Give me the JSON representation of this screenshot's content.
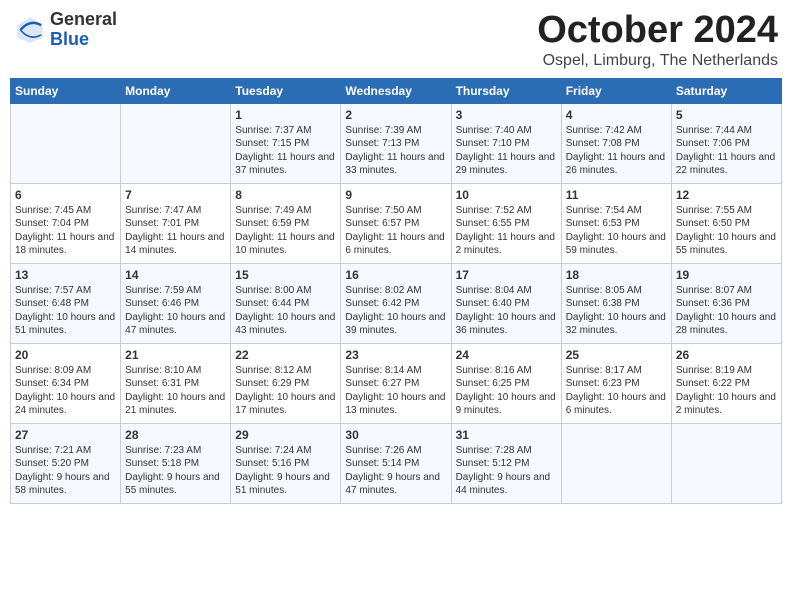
{
  "header": {
    "logo_general": "General",
    "logo_blue": "Blue",
    "month": "October 2024",
    "location": "Ospel, Limburg, The Netherlands"
  },
  "days_of_week": [
    "Sunday",
    "Monday",
    "Tuesday",
    "Wednesday",
    "Thursday",
    "Friday",
    "Saturday"
  ],
  "weeks": [
    [
      {
        "day": "",
        "info": ""
      },
      {
        "day": "",
        "info": ""
      },
      {
        "day": "1",
        "info": "Sunrise: 7:37 AM\nSunset: 7:15 PM\nDaylight: 11 hours and 37 minutes."
      },
      {
        "day": "2",
        "info": "Sunrise: 7:39 AM\nSunset: 7:13 PM\nDaylight: 11 hours and 33 minutes."
      },
      {
        "day": "3",
        "info": "Sunrise: 7:40 AM\nSunset: 7:10 PM\nDaylight: 11 hours and 29 minutes."
      },
      {
        "day": "4",
        "info": "Sunrise: 7:42 AM\nSunset: 7:08 PM\nDaylight: 11 hours and 26 minutes."
      },
      {
        "day": "5",
        "info": "Sunrise: 7:44 AM\nSunset: 7:06 PM\nDaylight: 11 hours and 22 minutes."
      }
    ],
    [
      {
        "day": "6",
        "info": "Sunrise: 7:45 AM\nSunset: 7:04 PM\nDaylight: 11 hours and 18 minutes."
      },
      {
        "day": "7",
        "info": "Sunrise: 7:47 AM\nSunset: 7:01 PM\nDaylight: 11 hours and 14 minutes."
      },
      {
        "day": "8",
        "info": "Sunrise: 7:49 AM\nSunset: 6:59 PM\nDaylight: 11 hours and 10 minutes."
      },
      {
        "day": "9",
        "info": "Sunrise: 7:50 AM\nSunset: 6:57 PM\nDaylight: 11 hours and 6 minutes."
      },
      {
        "day": "10",
        "info": "Sunrise: 7:52 AM\nSunset: 6:55 PM\nDaylight: 11 hours and 2 minutes."
      },
      {
        "day": "11",
        "info": "Sunrise: 7:54 AM\nSunset: 6:53 PM\nDaylight: 10 hours and 59 minutes."
      },
      {
        "day": "12",
        "info": "Sunrise: 7:55 AM\nSunset: 6:50 PM\nDaylight: 10 hours and 55 minutes."
      }
    ],
    [
      {
        "day": "13",
        "info": "Sunrise: 7:57 AM\nSunset: 6:48 PM\nDaylight: 10 hours and 51 minutes."
      },
      {
        "day": "14",
        "info": "Sunrise: 7:59 AM\nSunset: 6:46 PM\nDaylight: 10 hours and 47 minutes."
      },
      {
        "day": "15",
        "info": "Sunrise: 8:00 AM\nSunset: 6:44 PM\nDaylight: 10 hours and 43 minutes."
      },
      {
        "day": "16",
        "info": "Sunrise: 8:02 AM\nSunset: 6:42 PM\nDaylight: 10 hours and 39 minutes."
      },
      {
        "day": "17",
        "info": "Sunrise: 8:04 AM\nSunset: 6:40 PM\nDaylight: 10 hours and 36 minutes."
      },
      {
        "day": "18",
        "info": "Sunrise: 8:05 AM\nSunset: 6:38 PM\nDaylight: 10 hours and 32 minutes."
      },
      {
        "day": "19",
        "info": "Sunrise: 8:07 AM\nSunset: 6:36 PM\nDaylight: 10 hours and 28 minutes."
      }
    ],
    [
      {
        "day": "20",
        "info": "Sunrise: 8:09 AM\nSunset: 6:34 PM\nDaylight: 10 hours and 24 minutes."
      },
      {
        "day": "21",
        "info": "Sunrise: 8:10 AM\nSunset: 6:31 PM\nDaylight: 10 hours and 21 minutes."
      },
      {
        "day": "22",
        "info": "Sunrise: 8:12 AM\nSunset: 6:29 PM\nDaylight: 10 hours and 17 minutes."
      },
      {
        "day": "23",
        "info": "Sunrise: 8:14 AM\nSunset: 6:27 PM\nDaylight: 10 hours and 13 minutes."
      },
      {
        "day": "24",
        "info": "Sunrise: 8:16 AM\nSunset: 6:25 PM\nDaylight: 10 hours and 9 minutes."
      },
      {
        "day": "25",
        "info": "Sunrise: 8:17 AM\nSunset: 6:23 PM\nDaylight: 10 hours and 6 minutes."
      },
      {
        "day": "26",
        "info": "Sunrise: 8:19 AM\nSunset: 6:22 PM\nDaylight: 10 hours and 2 minutes."
      }
    ],
    [
      {
        "day": "27",
        "info": "Sunrise: 7:21 AM\nSunset: 5:20 PM\nDaylight: 9 hours and 58 minutes."
      },
      {
        "day": "28",
        "info": "Sunrise: 7:23 AM\nSunset: 5:18 PM\nDaylight: 9 hours and 55 minutes."
      },
      {
        "day": "29",
        "info": "Sunrise: 7:24 AM\nSunset: 5:16 PM\nDaylight: 9 hours and 51 minutes."
      },
      {
        "day": "30",
        "info": "Sunrise: 7:26 AM\nSunset: 5:14 PM\nDaylight: 9 hours and 47 minutes."
      },
      {
        "day": "31",
        "info": "Sunrise: 7:28 AM\nSunset: 5:12 PM\nDaylight: 9 hours and 44 minutes."
      },
      {
        "day": "",
        "info": ""
      },
      {
        "day": "",
        "info": ""
      }
    ]
  ]
}
